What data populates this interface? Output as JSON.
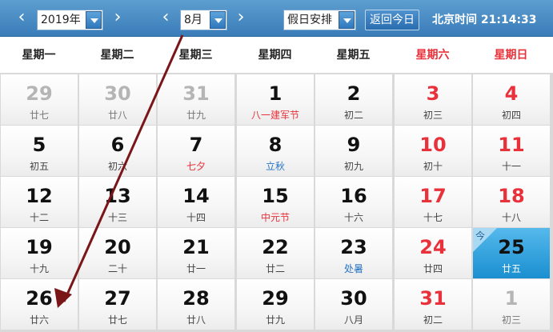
{
  "header": {
    "year_select": "2019年",
    "month_select": "8月",
    "holiday_select": "假日安排",
    "today_button": "返回今日",
    "clock_label": "北京时间",
    "clock_time": "21:14:33",
    "prev_icon": "chevron-left-icon",
    "next_icon": "chevron-right-icon"
  },
  "weekdays": [
    "星期一",
    "星期二",
    "星期三",
    "星期四",
    "星期五",
    "星期六",
    "星期日"
  ],
  "today_tag": "今",
  "weeks": [
    [
      {
        "day": "29",
        "sub": "廿七",
        "kind": "other"
      },
      {
        "day": "30",
        "sub": "廿八",
        "kind": "other"
      },
      {
        "day": "31",
        "sub": "廿九",
        "kind": "other"
      },
      {
        "day": "1",
        "sub": "八一建军节",
        "kind": "fest"
      },
      {
        "day": "2",
        "sub": "初二",
        "kind": ""
      },
      {
        "day": "3",
        "sub": "初三",
        "kind": "wkend"
      },
      {
        "day": "4",
        "sub": "初四",
        "kind": "wkend"
      }
    ],
    [
      {
        "day": "5",
        "sub": "初五",
        "kind": ""
      },
      {
        "day": "6",
        "sub": "初六",
        "kind": ""
      },
      {
        "day": "7",
        "sub": "七夕",
        "kind": "fest"
      },
      {
        "day": "8",
        "sub": "立秋",
        "kind": "term"
      },
      {
        "day": "9",
        "sub": "初九",
        "kind": ""
      },
      {
        "day": "10",
        "sub": "初十",
        "kind": "wkend"
      },
      {
        "day": "11",
        "sub": "十一",
        "kind": "wkend"
      }
    ],
    [
      {
        "day": "12",
        "sub": "十二",
        "kind": ""
      },
      {
        "day": "13",
        "sub": "十三",
        "kind": ""
      },
      {
        "day": "14",
        "sub": "十四",
        "kind": ""
      },
      {
        "day": "15",
        "sub": "中元节",
        "kind": "fest"
      },
      {
        "day": "16",
        "sub": "十六",
        "kind": ""
      },
      {
        "day": "17",
        "sub": "十七",
        "kind": "wkend"
      },
      {
        "day": "18",
        "sub": "十八",
        "kind": "wkend"
      }
    ],
    [
      {
        "day": "19",
        "sub": "十九",
        "kind": ""
      },
      {
        "day": "20",
        "sub": "二十",
        "kind": ""
      },
      {
        "day": "21",
        "sub": "廿一",
        "kind": ""
      },
      {
        "day": "22",
        "sub": "廿二",
        "kind": ""
      },
      {
        "day": "23",
        "sub": "处暑",
        "kind": "term"
      },
      {
        "day": "24",
        "sub": "廿四",
        "kind": "wkend"
      },
      {
        "day": "25",
        "sub": "廿五",
        "kind": "today"
      }
    ],
    [
      {
        "day": "26",
        "sub": "廿六",
        "kind": ""
      },
      {
        "day": "27",
        "sub": "廿七",
        "kind": ""
      },
      {
        "day": "28",
        "sub": "廿八",
        "kind": ""
      },
      {
        "day": "29",
        "sub": "廿九",
        "kind": ""
      },
      {
        "day": "30",
        "sub": "八月",
        "kind": ""
      },
      {
        "day": "31",
        "sub": "初二",
        "kind": "wkend"
      },
      {
        "day": "1",
        "sub": "初三",
        "kind": "other"
      }
    ]
  ],
  "colors": {
    "header_blue": "#3a7cb8",
    "weekend_red": "#e8313a",
    "solar_term_blue": "#2874c4",
    "today_cell": "#1a8fd0",
    "annotation_arrow": "#7a1518"
  }
}
